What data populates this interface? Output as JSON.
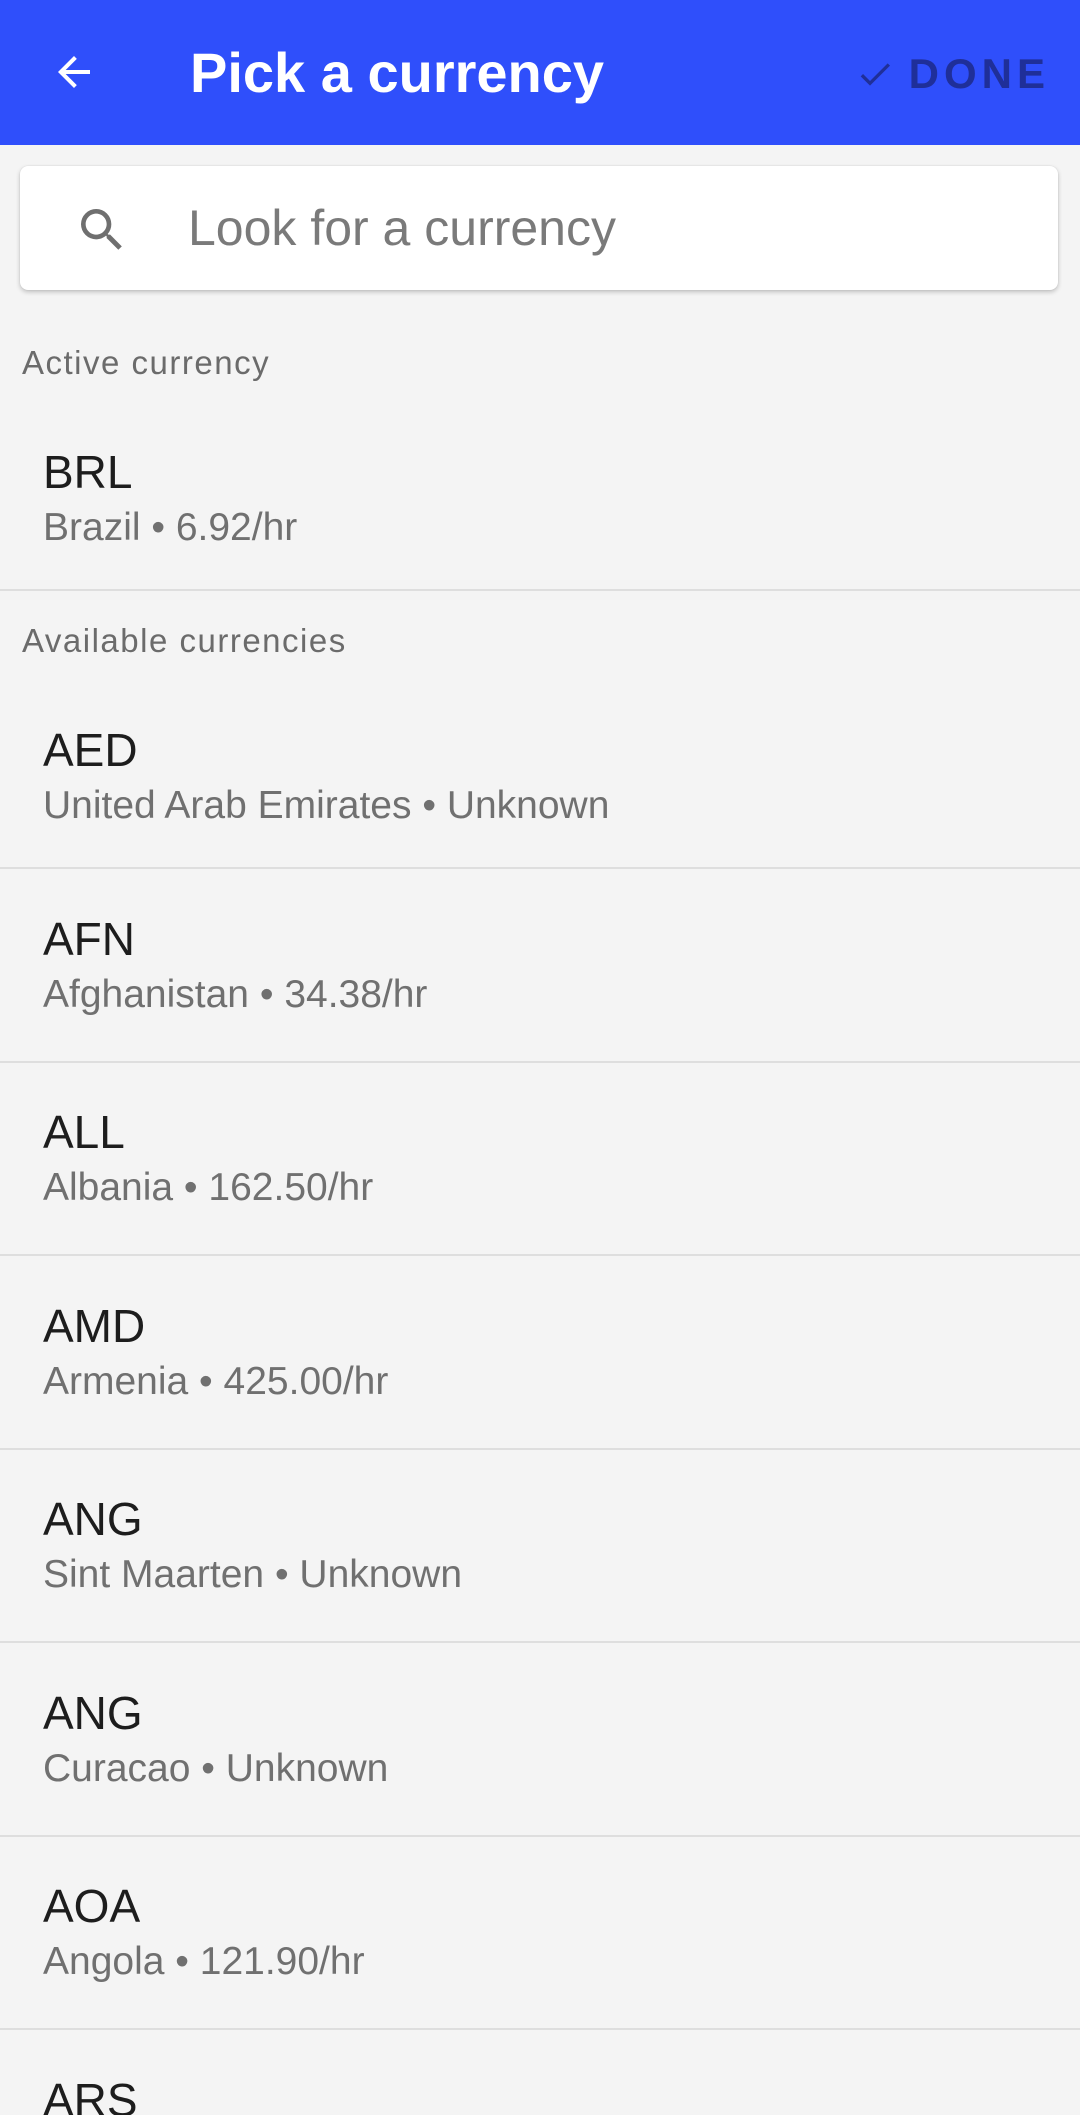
{
  "appbar": {
    "title": "Pick a currency",
    "done_label": "DONE",
    "back_icon": "arrow-left-icon",
    "done_icon": "check-icon",
    "color": "#2f4ffb"
  },
  "search": {
    "placeholder": "Look for a currency",
    "value": "",
    "icon": "search-icon"
  },
  "active_section": {
    "header": "Active currency",
    "items": [
      {
        "code": "BRL",
        "detail": "Brazil • 6.92/hr"
      }
    ]
  },
  "available_section": {
    "header": "Available currencies",
    "items": [
      {
        "code": "AED",
        "detail": "United Arab Emirates • Unknown"
      },
      {
        "code": "AFN",
        "detail": "Afghanistan • 34.38/hr"
      },
      {
        "code": "ALL",
        "detail": "Albania • 162.50/hr"
      },
      {
        "code": "AMD",
        "detail": "Armenia • 425.00/hr"
      },
      {
        "code": "ANG",
        "detail": "Sint Maarten • Unknown"
      },
      {
        "code": "ANG",
        "detail": "Curacao • Unknown"
      },
      {
        "code": "AOA",
        "detail": "Angola • 121.90/hr"
      },
      {
        "code": "ARS",
        "detail": ""
      }
    ]
  }
}
